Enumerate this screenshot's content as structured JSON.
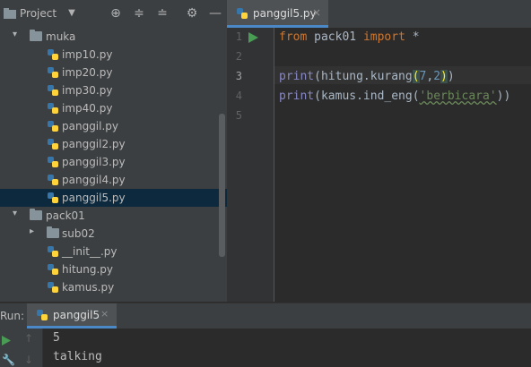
{
  "project_panel": {
    "title": "Project",
    "icons": [
      "chevron-down-icon",
      "locate-icon",
      "expand-all-icon",
      "collapse-all-icon",
      "gear-icon",
      "minimize-icon"
    ]
  },
  "tree": {
    "items": [
      {
        "label": "muka",
        "kind": "folder",
        "expanded": true
      },
      {
        "label": "imp10.py",
        "kind": "py"
      },
      {
        "label": "imp20.py",
        "kind": "py"
      },
      {
        "label": "imp30.py",
        "kind": "py"
      },
      {
        "label": "imp40.py",
        "kind": "py"
      },
      {
        "label": "panggil.py",
        "kind": "py"
      },
      {
        "label": "panggil2.py",
        "kind": "py"
      },
      {
        "label": "panggil3.py",
        "kind": "py"
      },
      {
        "label": "panggil4.py",
        "kind": "py"
      },
      {
        "label": "panggil5.py",
        "kind": "py",
        "selected": true
      },
      {
        "label": "pack01",
        "kind": "package",
        "expanded": true
      },
      {
        "label": "sub02",
        "kind": "package",
        "expanded": false
      },
      {
        "label": "__init__.py",
        "kind": "py"
      },
      {
        "label": "hitung.py",
        "kind": "py"
      },
      {
        "label": "kamus.py",
        "kind": "py"
      }
    ]
  },
  "editor": {
    "tab_label": "panggil5.py",
    "close_glyph": "×",
    "line_numbers": [
      "1",
      "2",
      "3",
      "4",
      "5"
    ],
    "code": {
      "line1": {
        "kw1": "from",
        "mod": " pack01 ",
        "kw2": "import",
        "rest": " *"
      },
      "line3": {
        "fn": "print",
        "a": "(hitung.kurang",
        "p_open": "(",
        "n1": "7",
        "sep": ",",
        "n2": "2",
        "p_close": ")",
        "end": ")"
      },
      "line4": {
        "fn": "print",
        "a": "(kamus.ind_eng(",
        "str": "'berbicara'",
        "end": "))"
      }
    }
  },
  "run": {
    "label": "Run:",
    "tab_label": "panggil5",
    "close_glyph": "×",
    "output": [
      "5",
      "talking"
    ]
  },
  "colors": {
    "background": "#2b2b2b",
    "panel": "#3c3f41",
    "selection": "#0d293e",
    "accent": "#4a88c7",
    "keyword": "#cc7832",
    "number": "#6897bb",
    "string": "#6a8759",
    "builtin": "#8888c6"
  }
}
